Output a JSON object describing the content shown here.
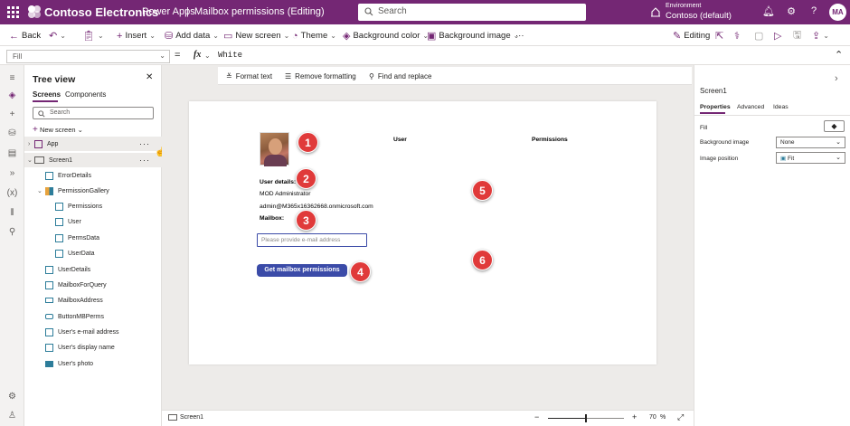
{
  "topbar": {
    "brand": "Contoso Electronics",
    "app": "Power Apps",
    "separator": "|",
    "document": "Mailbox permissions (Editing)",
    "search_placeholder": "Search",
    "env_label": "Environment",
    "env_value": "Contoso (default)",
    "avatar": "MA",
    "bg_color": "#742774"
  },
  "commands": {
    "back": "Back",
    "insert": "Insert",
    "add_data": "Add data",
    "new_screen": "New screen",
    "theme": "Theme",
    "background_color": "Background color",
    "background_image": "Background image",
    "more": "···",
    "editing": "Editing"
  },
  "formula": {
    "property": "Fill",
    "eq": "=",
    "fx": "fx",
    "value": "White"
  },
  "format_bar": {
    "format_text": "Format text",
    "remove_formatting": "Remove formatting",
    "find_replace": "Find and replace"
  },
  "tree": {
    "title": "Tree view",
    "tab_screens": "Screens",
    "tab_components": "Components",
    "search_placeholder": "Search",
    "new_screen": "New screen",
    "nodes": [
      {
        "label": "App"
      },
      {
        "label": "Screen1"
      },
      {
        "label": "ErrorDetails"
      },
      {
        "label": "PermissionGallery"
      },
      {
        "label": "Permissions"
      },
      {
        "label": "User"
      },
      {
        "label": "PermsData"
      },
      {
        "label": "UserData"
      },
      {
        "label": "UserDetails"
      },
      {
        "label": "MailboxForQuery"
      },
      {
        "label": "MailboxAddress"
      },
      {
        "label": "ButtonMBPerms"
      },
      {
        "label": "User's e-mail address"
      },
      {
        "label": "User's display name"
      },
      {
        "label": "User's photo"
      }
    ],
    "dots": "···"
  },
  "screen": {
    "header_user": "User",
    "header_permissions": "Permissions",
    "user_details_label": "User details:",
    "display_name": "MOD Administrator",
    "email": "admin@M365x16362668.onmicrosoft.com",
    "mailbox_label": "Mailbox:",
    "mailbox_placeholder": "Please provide e-mail address",
    "button_label": "Get mailbox permissions",
    "callouts": [
      "1",
      "2",
      "3",
      "4",
      "5",
      "6"
    ],
    "callout_color": "#e03a3a",
    "button_color": "#3b4ba8"
  },
  "status": {
    "screen_name": "Screen1",
    "zoom_minus": "−",
    "zoom_plus": "+",
    "zoom_value": "70",
    "zoom_unit": "%",
    "zoom_fraction": 0.5
  },
  "properties": {
    "title": "Screen1",
    "tab_properties": "Properties",
    "tab_advanced": "Advanced",
    "tab_ideas": "Ideas",
    "fill_label": "Fill",
    "bg_image_label": "Background image",
    "bg_image_value": "None",
    "image_position_label": "Image position",
    "image_position_value": "Fit"
  }
}
